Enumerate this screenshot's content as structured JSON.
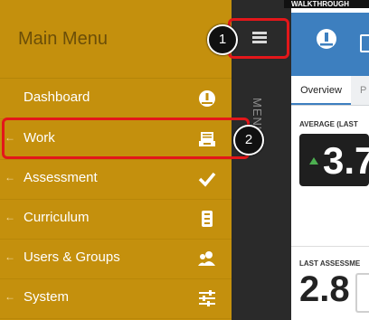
{
  "sidebar": {
    "title": "Main Menu",
    "items": [
      {
        "label": "Dashboard",
        "icon": "gauge-icon",
        "has_arrow": false
      },
      {
        "label": "Work",
        "icon": "tray-icon",
        "has_arrow": true
      },
      {
        "label": "Assessment",
        "icon": "check-icon",
        "has_arrow": true
      },
      {
        "label": "Curriculum",
        "icon": "binder-icon",
        "has_arrow": true
      },
      {
        "label": "Users & Groups",
        "icon": "users-icon",
        "has_arrow": true
      },
      {
        "label": "System",
        "icon": "sliders-icon",
        "has_arrow": true
      }
    ],
    "arrow_glyph": "←"
  },
  "strip": {
    "vertical_label": "MENU"
  },
  "header": {
    "walkthrough_label": "WALKTHROUGH"
  },
  "tabs": {
    "overview": "Overview",
    "partial_next": "P"
  },
  "average": {
    "label": "AVERAGE (LAST",
    "value": "3.7"
  },
  "last_assessment": {
    "label": "LAST ASSESSME",
    "value": "2.8"
  },
  "callouts": {
    "one": "1",
    "two": "2"
  },
  "colors": {
    "sidebar": "#c4900d",
    "strip": "#2a2a2a",
    "header_blue": "#3d7fbf",
    "callout_red": "#e3171a"
  }
}
